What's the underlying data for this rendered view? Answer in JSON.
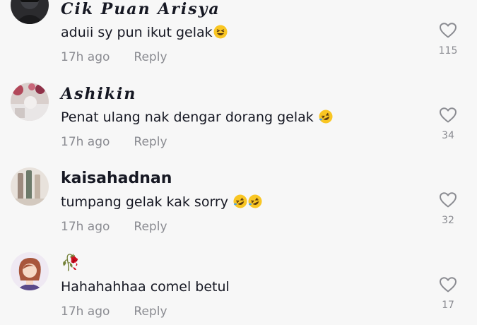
{
  "comments": [
    {
      "username": "𝑪𝒊𝒌 𝑷𝒖𝒂𝒏 𝑨𝒓𝒊𝒔𝒚𝒂",
      "text": "aduii sy pun ikut gelak",
      "emoji": [
        "grinning-squinting"
      ],
      "time": "17h ago",
      "reply": "Reply",
      "likes": "115"
    },
    {
      "username": "𝑨𝒔𝒉𝒊𝒌𝒊𝒏",
      "text": "Penat ulang nak dengar dorang gelak ",
      "emoji": [
        "rolling-on-floor-laughing"
      ],
      "time": "17h ago",
      "reply": "Reply",
      "likes": "34"
    },
    {
      "username": "kaisahadnan",
      "text": "tumpang gelak kak sorry ",
      "emoji": [
        "rolling-on-floor-laughing",
        "rolling-on-floor-laughing"
      ],
      "time": "17h ago",
      "reply": "Reply",
      "likes": "32"
    },
    {
      "username": "🥀",
      "text": "Hahahahhaa comel betul",
      "emoji": [],
      "time": "17h ago",
      "reply": "Reply",
      "likes": "17"
    }
  ],
  "colors": {
    "background": "#f7f7f7",
    "text": "#161823",
    "muted": "#8a8b91",
    "emoji": "#f9c623"
  },
  "icons": {
    "like": "heart-outline-icon"
  }
}
